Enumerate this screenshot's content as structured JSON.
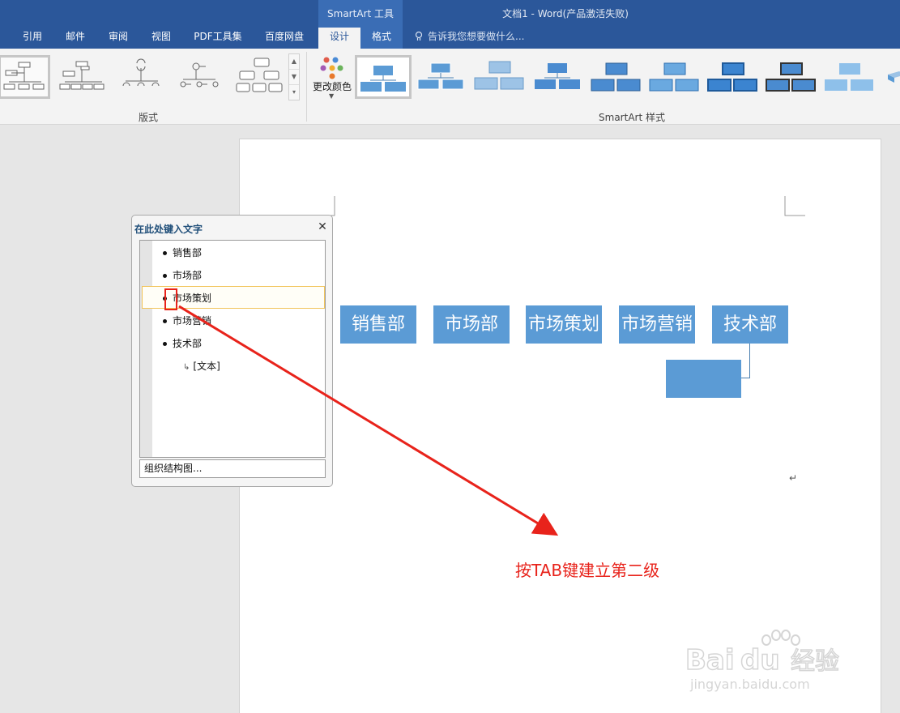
{
  "titlebar": {
    "context_label": "SmartArt 工具",
    "doc_title": "文档1 - Word(产品激活失败)",
    "tabs": [
      {
        "label": "引用",
        "active": false
      },
      {
        "label": "邮件",
        "active": false
      },
      {
        "label": "审阅",
        "active": false
      },
      {
        "label": "视图",
        "active": false
      },
      {
        "label": "PDF工具集",
        "active": false
      },
      {
        "label": "百度网盘",
        "active": false
      },
      {
        "label": "设计",
        "active": true
      },
      {
        "label": "格式",
        "active": false
      }
    ],
    "tell_me": "告诉我您想要做什么..."
  },
  "ribbon": {
    "layout_group_label": "版式",
    "change_color_label": "更改颜色",
    "styles_group_label": "SmartArt 样式"
  },
  "document": {
    "org_boxes": [
      "销售部",
      "市场部",
      "市场策划",
      "市场营销",
      "技术部"
    ],
    "org_sub_box": ""
  },
  "text_pane": {
    "title": "在此处键入文字",
    "items": [
      "销售部",
      "市场部",
      "市场策划",
      "市场营销",
      "技术部"
    ],
    "sub_item": "[文本]",
    "footer": "组织结构图..."
  },
  "annotation": "按TAB键建立第二级",
  "watermark": {
    "brand": "Baidu经验",
    "url": "jingyan.baidu.com"
  },
  "colors": {
    "titlebar": "#2b579a",
    "box_fill": "#5b9bd5",
    "annotation": "#e8231b"
  }
}
